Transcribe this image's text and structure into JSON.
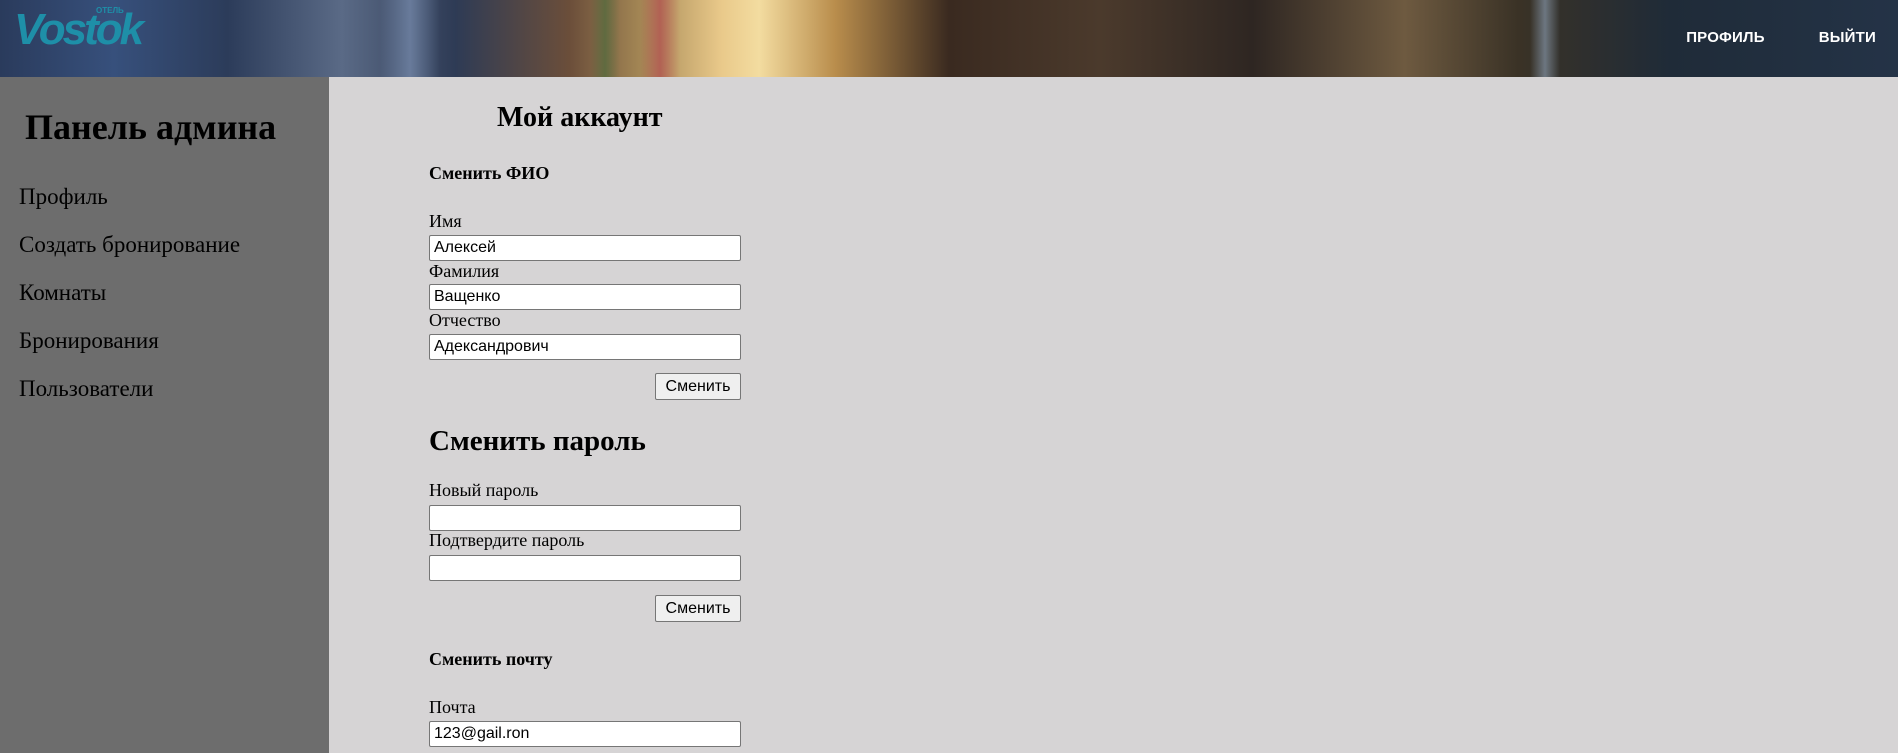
{
  "header": {
    "logo_text": "Vostok",
    "logo_small": "ОТЕЛЬ",
    "nav": {
      "profile": "ПРОФИЛЬ",
      "logout": "ВЫЙТИ"
    }
  },
  "sidebar": {
    "title": "Панель админа",
    "items": [
      {
        "label": "Профиль"
      },
      {
        "label": "Создать бронирование"
      },
      {
        "label": "Комнаты"
      },
      {
        "label": "Бронирования"
      },
      {
        "label": "Пользователи"
      }
    ]
  },
  "main": {
    "title": "Мой аккаунт",
    "fio_section": {
      "heading": "Сменить ФИО",
      "first_name_label": "Имя",
      "first_name_value": "Алексей",
      "last_name_label": "Фамилия",
      "last_name_value": "Ващенко",
      "patronymic_label": "Отчество",
      "patronymic_value": "Адександрович",
      "submit_label": "Сменить"
    },
    "password_section": {
      "heading": "Сменить пароль",
      "new_password_label": "Новый пароль",
      "new_password_value": "",
      "confirm_password_label": "Подтвердите пароль",
      "confirm_password_value": "",
      "submit_label": "Сменить"
    },
    "email_section": {
      "heading": "Сменить почту",
      "email_label": "Почта",
      "email_value": "123@gail.ron"
    }
  }
}
